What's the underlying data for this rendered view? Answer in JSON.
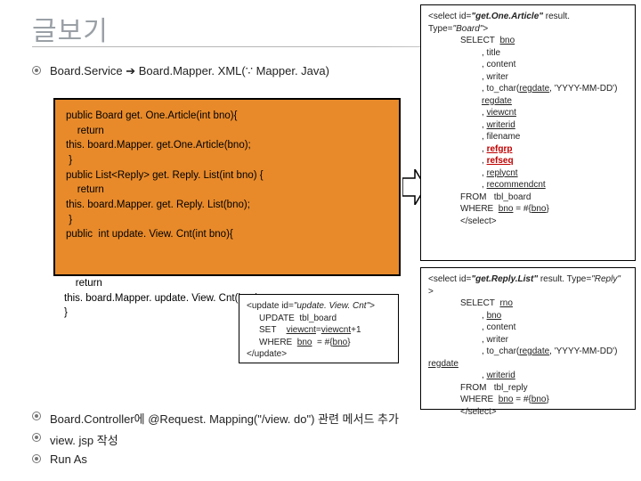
{
  "title": "글보기",
  "flow": "Board.Service ➔ Board.Mapper. XML(∵ Mapper. Java)",
  "java_code": "public Board get. One.Article(int bno){\n    return\nthis. board.Mapper. get.One.Article(bno);\n }\npublic List<Reply> get. Reply. List(int bno) {\n    return\nthis. board.Mapper. get. Reply. List(bno);\n }\npublic  int update. View. Cnt(int bno){",
  "java_overflow": "    return\nthis. board.Mapper. update. View. Cnt(bno);\n}",
  "xml1": {
    "open": "<select id=\"get.One.Article\" result. Type=\"Board\">",
    "lines": [
      "SELECT  bno",
      ", title",
      ", content",
      ", writer",
      ", to_char(regdate, 'YYYY-MM-DD') regdate",
      ", viewcnt",
      ", writerid",
      ", filename",
      ", refgrp",
      ", refseq",
      ", replycnt",
      ", recommendcnt",
      "FROM   tbl_board",
      "WHERE  bno = #{bno}",
      "</select>"
    ]
  },
  "xml2": {
    "open": "<select id=\"get.Reply.List\" result. Type=\"Reply\" >",
    "lines": [
      "SELECT  rno",
      ", bno",
      ", content",
      ", writer",
      ", to_char(regdate, 'YYYY-MM-DD')",
      "regdate",
      ", writerid",
      "FROM   tbl_reply",
      "WHERE  bno = #{bno}",
      "</select>"
    ]
  },
  "xml3": {
    "open": "<update id=\"update. View. Cnt\">",
    "lines": [
      "UPDATE  tbl_board",
      "SET    viewcnt=viewcnt+1",
      "WHERE  bno  = #{bno}",
      "</update>"
    ]
  },
  "bullets": [
    "Board.Controller에  @Request. Mapping(\"/view. do\") 관련 메서드 추가",
    "view. jsp 작성",
    "Run As"
  ]
}
